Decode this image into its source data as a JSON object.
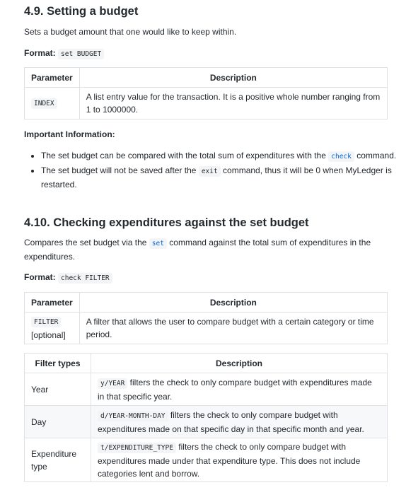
{
  "section1": {
    "title": "4.9. Setting a budget",
    "intro": "Sets a budget amount that one would like to keep within.",
    "format_label": "Format:",
    "format_code": "set BUDGET",
    "table": {
      "headers": [
        "Parameter",
        "Description"
      ],
      "rows": [
        {
          "param": "INDEX",
          "desc": "A list entry value for the transaction. It is a positive whole number ranging from 1 to 1000000."
        }
      ]
    },
    "important_label": "Important Information:",
    "bullets": [
      {
        "before": "The set budget can be compared with the total sum of expenditures with the ",
        "code": "check",
        "after": " command."
      },
      {
        "before": "The set budget will not be saved after the ",
        "code": "exit",
        "after": " command, thus it will be 0 when MyLedger is restarted."
      }
    ]
  },
  "section2": {
    "title": "4.10. Checking expenditures against the set budget",
    "intro_before": "Compares the set budget via the ",
    "intro_code": "set",
    "intro_after": " command against the total sum of expenditures in the expenditures.",
    "format_label": "Format:",
    "format_code": "check FILTER",
    "param_table": {
      "headers": [
        "Parameter",
        "Description"
      ],
      "rows": [
        {
          "param": "FILTER",
          "note": "[optional]",
          "desc": "A filter that allows the user to compare budget with a certain category or time period."
        }
      ]
    },
    "filter_table": {
      "headers": [
        "Filter types",
        "Description"
      ],
      "rows": [
        {
          "type": "Year",
          "code": "y/YEAR",
          "desc": " filters the check to only compare budget with expenditures made in that specific year."
        },
        {
          "type": "Day",
          "code": "d/YEAR-MONTH-DAY",
          "desc": " filters the check to only compare budget with expenditures made on that specific day in that specific month and year."
        },
        {
          "type": "Expenditure type",
          "code": "t/EXPENDITURE_TYPE",
          "desc": " filters the check to only compare budget with expenditures made under that expenditure type. This does not include categories lent and borrow."
        }
      ]
    }
  }
}
